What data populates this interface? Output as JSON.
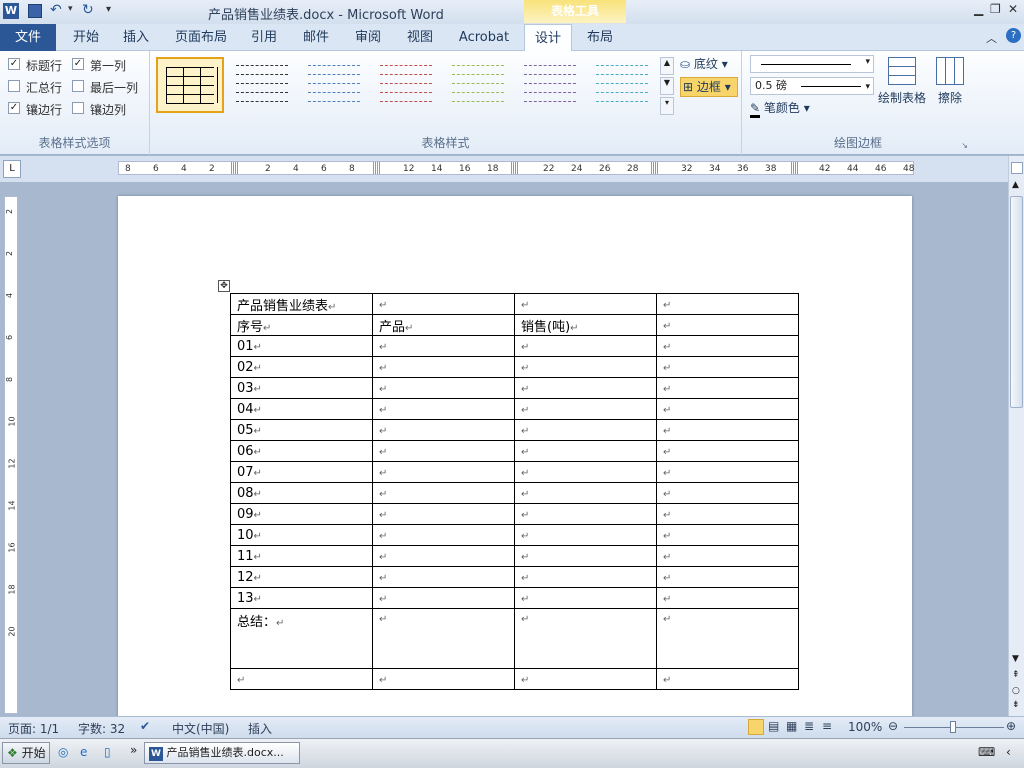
{
  "window": {
    "title": "产品销售业绩表.docx - Microsoft Word",
    "context_tab_group": "表格工具",
    "help": "?"
  },
  "tabs": [
    {
      "label": "文件"
    },
    {
      "label": "开始"
    },
    {
      "label": "插入"
    },
    {
      "label": "页面布局"
    },
    {
      "label": "引用"
    },
    {
      "label": "邮件"
    },
    {
      "label": "审阅"
    },
    {
      "label": "视图"
    },
    {
      "label": "Acrobat"
    },
    {
      "label": "设计"
    },
    {
      "label": "布局"
    }
  ],
  "active_tab": "设计",
  "ribbon": {
    "style_options": {
      "label": "表格样式选项",
      "checks": [
        {
          "label": "标题行",
          "checked": true
        },
        {
          "label": "第一列",
          "checked": true
        },
        {
          "label": "汇总行",
          "checked": false
        },
        {
          "label": "最后一列",
          "checked": false
        },
        {
          "label": "镶边行",
          "checked": true
        },
        {
          "label": "镶边列",
          "checked": false
        }
      ]
    },
    "table_styles": {
      "label": "表格样式",
      "shading": "底纹",
      "borders": "边框",
      "thumb_colors": [
        "#000000",
        "#333333",
        "#4f81bd",
        "#c0504d",
        "#9bbb59",
        "#8064a2",
        "#4bacc6"
      ]
    },
    "draw_borders": {
      "label": "绘图边框",
      "weight": "0.5 磅",
      "pen_color": "笔颜色",
      "draw_table": "绘制表格",
      "eraser": "擦除"
    }
  },
  "ruler_ticks": [
    "8",
    "6",
    "4",
    "2",
    "2",
    "4",
    "6",
    "8",
    "12",
    "14",
    "16",
    "18",
    "22",
    "24",
    "26",
    "28",
    "32",
    "34",
    "36",
    "38",
    "42",
    "44",
    "46",
    "48"
  ],
  "vruler_ticks": [
    "2",
    "2",
    "4",
    "6",
    "8",
    "10",
    "12",
    "14",
    "16",
    "18",
    "20"
  ],
  "document": {
    "para_mark": "↵",
    "rows": [
      [
        "产品销售业绩表",
        "",
        "",
        ""
      ],
      [
        "序号",
        "产品",
        "销售(吨)",
        ""
      ],
      [
        "01",
        "",
        "",
        ""
      ],
      [
        "02",
        "",
        "",
        ""
      ],
      [
        "03",
        "",
        "",
        ""
      ],
      [
        "04",
        "",
        "",
        ""
      ],
      [
        "05",
        "",
        "",
        ""
      ],
      [
        "06",
        "",
        "",
        ""
      ],
      [
        "07",
        "",
        "",
        ""
      ],
      [
        "08",
        "",
        "",
        ""
      ],
      [
        "09",
        "",
        "",
        ""
      ],
      [
        "10",
        "",
        "",
        ""
      ],
      [
        "11",
        "",
        "",
        ""
      ],
      [
        "12",
        "",
        "",
        ""
      ],
      [
        "13",
        "",
        "",
        ""
      ],
      [
        "总结：",
        "",
        "",
        ""
      ],
      [
        "",
        "",
        "",
        ""
      ]
    ]
  },
  "status": {
    "page": "页面: 1/1",
    "words": "字数: 32",
    "language": "中文(中国)",
    "mode": "插入",
    "zoom": "100%"
  },
  "taskbar": {
    "start": "开始",
    "window_button": "产品销售业绩表.docx..."
  }
}
